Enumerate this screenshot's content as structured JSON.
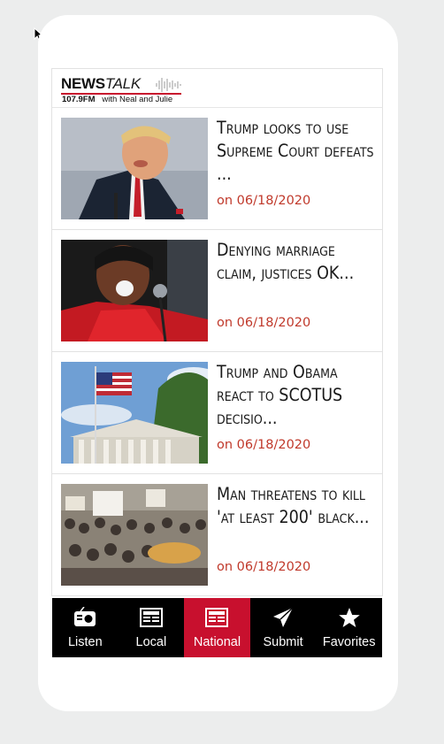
{
  "brand": {
    "name_bold": "NEWS",
    "name_italic": "TALK",
    "frequency": "107.9FM",
    "tagline": "with Neal and Julie",
    "accent": "#c8102e"
  },
  "articles": [
    {
      "headline": "Trump looks to use Supreme Court defeats ...",
      "date": "on 06/18/2020",
      "thumb": "trump-portrait"
    },
    {
      "headline": "Denying marriage claim, justices OK...",
      "date": "on 06/18/2020",
      "thumb": "singer-red-suit"
    },
    {
      "headline": "Trump and Obama react to SCOTUS decisio...",
      "date": "on 06/18/2020",
      "thumb": "supreme-court-flag"
    },
    {
      "headline": "Man threatens to kill 'at least 200' black...",
      "date": "on 06/18/2020",
      "thumb": "protest-crowd"
    }
  ],
  "tabs": [
    {
      "label": "Listen",
      "icon": "radio-icon",
      "active": false
    },
    {
      "label": "Local",
      "icon": "newspaper-icon",
      "active": false
    },
    {
      "label": "National",
      "icon": "newspaper-icon",
      "active": true
    },
    {
      "label": "Submit",
      "icon": "paper-plane-icon",
      "active": false
    },
    {
      "label": "Favorites",
      "icon": "star-icon",
      "active": false
    }
  ],
  "colors": {
    "date": "#c0392b",
    "tab_bar": "#000000",
    "tab_active": "#c8102e"
  }
}
